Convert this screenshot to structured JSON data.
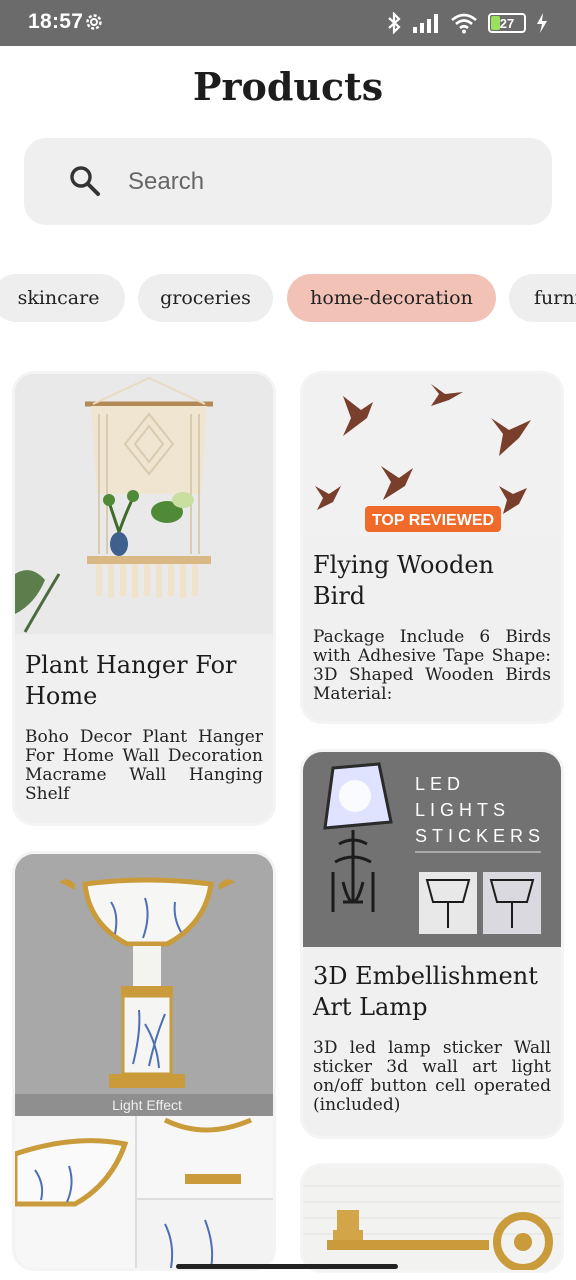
{
  "status_bar": {
    "time": "18:57",
    "battery": "27",
    "battery_level": 0.27,
    "icons": [
      "gear-icon",
      "bluetooth-icon",
      "signal-icon",
      "wifi-icon",
      "battery-icon",
      "charging-icon"
    ]
  },
  "header": {
    "title": "Products"
  },
  "search": {
    "placeholder": "Search",
    "value": ""
  },
  "categories": [
    {
      "label": "skincare",
      "active": false
    },
    {
      "label": "groceries",
      "active": false
    },
    {
      "label": "home-decoration",
      "active": true
    },
    {
      "label": "furni",
      "active": false
    }
  ],
  "products": [
    {
      "title": "Plant Hanger For Home",
      "description": "Boho Decor Plant Hanger For Home Wall Decoration Macrame Wall Hanging Shelf",
      "image": "macrame-plant-hanger"
    },
    {
      "title": "Flying Wooden Bird",
      "description": "Package Include 6 Birds with Adhesive Tape Shape: 3D Shaped Wooden Birds Material:",
      "image": "wooden-birds",
      "badge": "TOP REVIEWED"
    },
    {
      "title": "",
      "description": "",
      "image": "ceramic-vase",
      "overlay": "Light Effect"
    },
    {
      "title": "3D Embellishment Art Lamp",
      "description": "3D led lamp sticker Wall sticker 3d wall art light on/off button cell operated (included)",
      "image": "led-lamp-sticker",
      "image_text": [
        "LED",
        "LIGHTS",
        "STICKERS"
      ]
    },
    {
      "title": "",
      "description": "",
      "image": "brass-key-holder"
    }
  ],
  "colors": {
    "status_bar": "#6b6b6b",
    "chip": "#eeeeee",
    "chip_active": "#f3c2b7",
    "card": "#f0f0f0",
    "badge": "#f06a2a"
  }
}
